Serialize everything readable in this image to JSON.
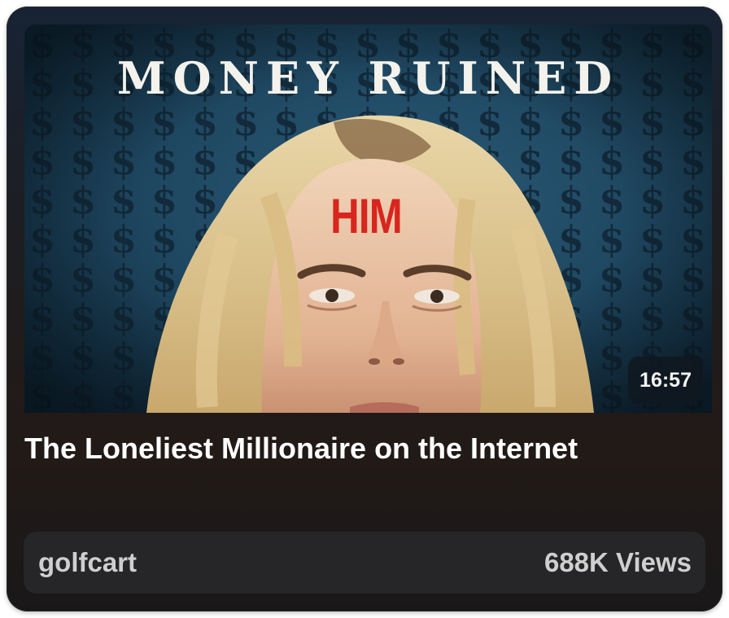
{
  "thumbnail": {
    "headline": "MONEY RUINED",
    "subheadline": "HIM",
    "duration": "16:57"
  },
  "video": {
    "title": "The Loneliest Millionaire on the Internet"
  },
  "footer": {
    "channel": "golfcart",
    "views": "688K Views"
  }
}
